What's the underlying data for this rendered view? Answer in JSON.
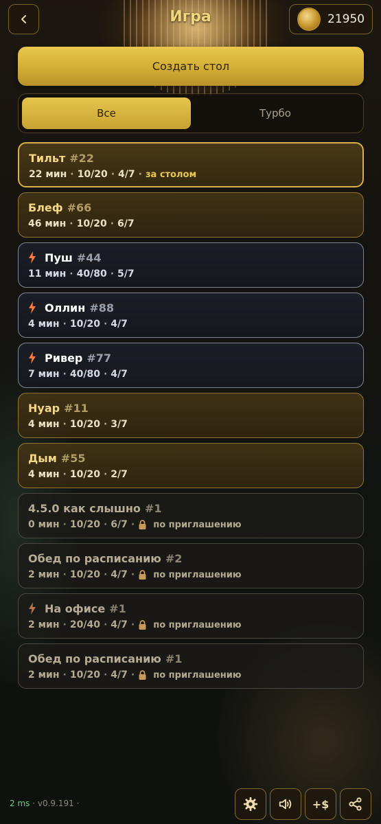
{
  "header": {
    "title": "Игра",
    "back_icon": "chevron-left-icon",
    "balance": "21950",
    "coin_icon": "coin-icon"
  },
  "actions": {
    "create_table_label": "Создать стол"
  },
  "tabs": [
    {
      "label": "Все",
      "active": true
    },
    {
      "label": "Турбо",
      "active": false
    }
  ],
  "tables": [
    {
      "name": "Тильт",
      "number": "#22",
      "time": "22 мин",
      "blinds": "10/20",
      "seats": "4/7",
      "status": "за столом",
      "turbo": false,
      "private": false
    },
    {
      "name": "Блеф",
      "number": "#66",
      "time": "46 мин",
      "blinds": "10/20",
      "seats": "6/7",
      "turbo": false,
      "private": false
    },
    {
      "name": "Пуш",
      "number": "#44",
      "time": "11 мин",
      "blinds": "40/80",
      "seats": "5/7",
      "turbo": true,
      "private": false
    },
    {
      "name": "Оллин",
      "number": "#88",
      "time": "4 мин",
      "blinds": "10/20",
      "seats": "4/7",
      "turbo": true,
      "private": false
    },
    {
      "name": "Ривер",
      "number": "#77",
      "time": "7 мин",
      "blinds": "40/80",
      "seats": "4/7",
      "turbo": true,
      "private": false
    },
    {
      "name": "Нуар",
      "number": "#11",
      "time": "4 мин",
      "blinds": "10/20",
      "seats": "3/7",
      "turbo": false,
      "private": false
    },
    {
      "name": "Дым",
      "number": "#55",
      "time": "4 мин",
      "blinds": "10/20",
      "seats": "2/7",
      "turbo": false,
      "private": false
    },
    {
      "name": "4.5.0 как слышно",
      "number": "#1",
      "time": "0 мин",
      "blinds": "10/20",
      "seats": "6/7",
      "invite": "по приглашению",
      "turbo": false,
      "private": true
    },
    {
      "name": "Обед по расписанию",
      "number": "#2",
      "time": "2 мин",
      "blinds": "10/20",
      "seats": "4/7",
      "invite": "по приглашению",
      "turbo": false,
      "private": true
    },
    {
      "name": "На офисе",
      "number": "#1",
      "time": "2 мин",
      "blinds": "20/40",
      "seats": "4/7",
      "invite": "по приглашению",
      "turbo": true,
      "private": true
    },
    {
      "name": "Обед по расписанию",
      "number": "#1",
      "time": "2 мин",
      "blinds": "10/20",
      "seats": "4/7",
      "invite": "по приглашению",
      "turbo": false,
      "private": true
    }
  ],
  "footer": {
    "latency": "2 ms",
    "version": "v0.9.191",
    "separator": "·",
    "buttons": [
      {
        "icon": "gear-icon",
        "label": ""
      },
      {
        "icon": "speaker-icon",
        "label": ""
      },
      {
        "icon": "add-funds-icon",
        "label": "+$"
      },
      {
        "icon": "share-icon",
        "label": ""
      }
    ]
  },
  "colors": {
    "gold": "#e9c84d",
    "turbo_bolt": "#ff7a3d",
    "lock": "#c79a5a",
    "latency": "#5fd27e"
  }
}
